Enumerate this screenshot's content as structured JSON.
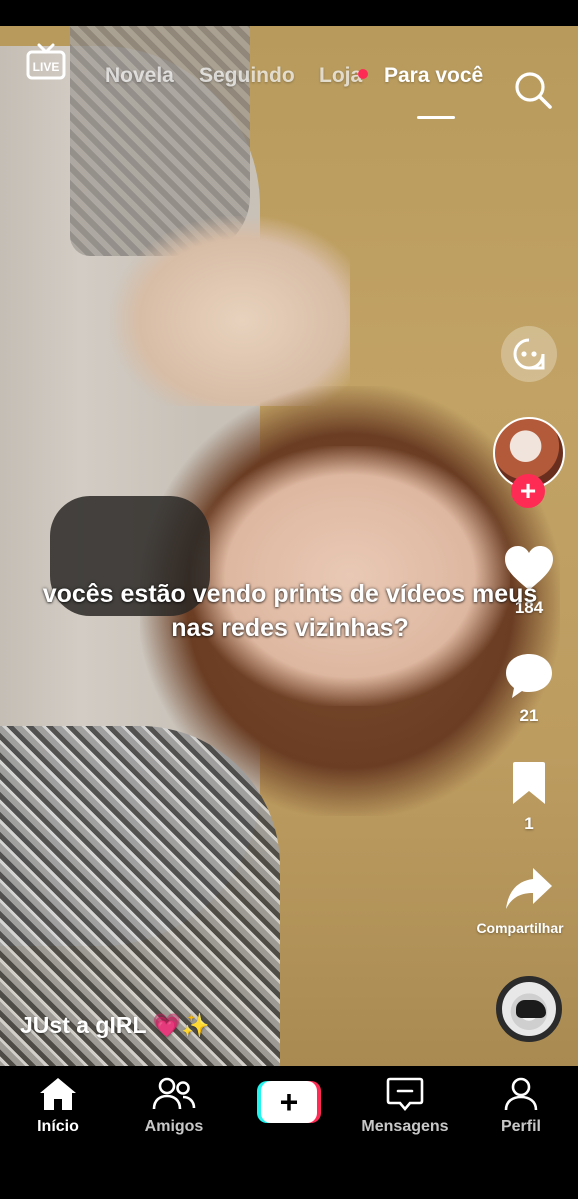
{
  "top_nav": {
    "live_label": "LIVE",
    "tabs": [
      {
        "label": "Novela",
        "active": false
      },
      {
        "label": "Seguindo",
        "active": false
      },
      {
        "label": "Loja",
        "active": false,
        "has_dot": true
      },
      {
        "label": "Para você",
        "active": true
      }
    ],
    "search_icon": "search-icon"
  },
  "video": {
    "caption": "vocês estão vendo prints de vídeos meus nas redes vizinhas?",
    "username": "JUst a gIRL 💗✨"
  },
  "actions": {
    "likes": "184",
    "comments": "21",
    "saves": "1",
    "share_label": "Compartilhar"
  },
  "bottom_nav": {
    "items": [
      {
        "label": "Início",
        "icon": "home-icon",
        "active": true
      },
      {
        "label": "Amigos",
        "icon": "friends-icon",
        "active": false
      },
      {
        "label": "Mensagens",
        "icon": "inbox-icon",
        "active": false
      },
      {
        "label": "Perfil",
        "icon": "profile-icon",
        "active": false
      }
    ],
    "create_icon": "plus-icon"
  },
  "colors": {
    "accent": "#fe2c55",
    "accent_cyan": "#25f4ee",
    "background": "#000000"
  }
}
